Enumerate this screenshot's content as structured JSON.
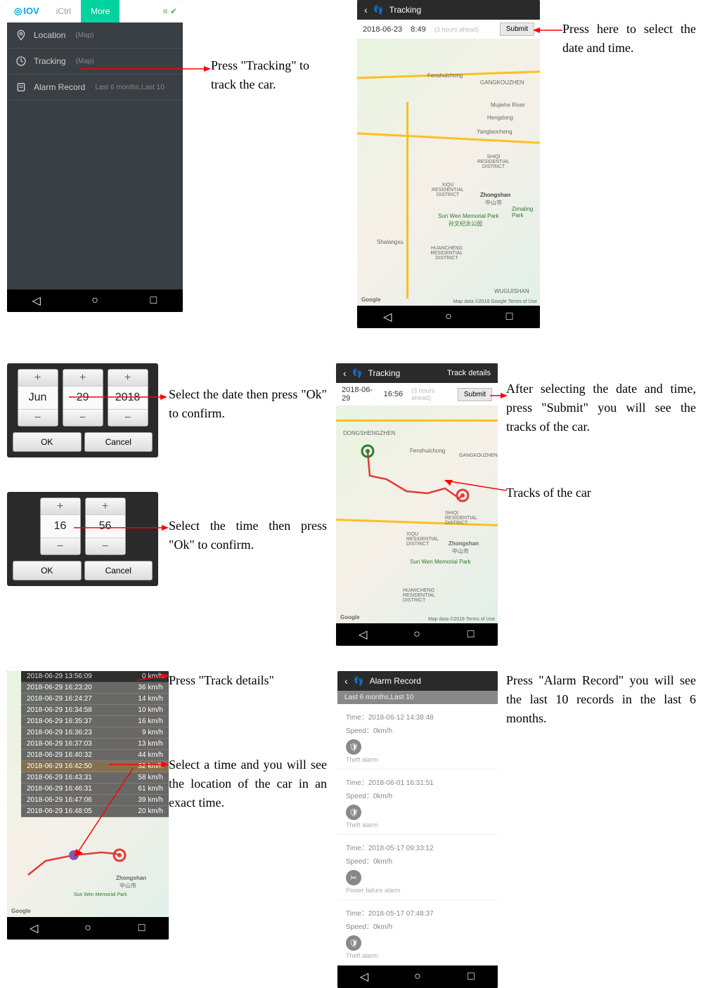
{
  "screen1": {
    "logo": "IOV",
    "tabs": {
      "ictrl": "iCtrl",
      "more": "More"
    },
    "items": [
      {
        "label": "Location",
        "sub": "(Map)"
      },
      {
        "label": "Tracking",
        "sub": "(Map)"
      },
      {
        "label": "Alarm Record",
        "sub": "Last 6 months,Last 10"
      }
    ]
  },
  "annot1": "Press \"Tracking\" to track the car.",
  "screen2": {
    "title": "Tracking",
    "date": "2018-06-23",
    "time": "8:49",
    "hint": "(3 hours ahead)",
    "submit": "Submit",
    "map_labels": {
      "zhongshan": "Zhongshan",
      "zhongshan_cn": "中山市",
      "sunwen": "Sun Wen Memorial Park",
      "sunwen_cn": "孙文纪念公园",
      "fenshuichong": "Fenshuichong",
      "gangkou": "GANGKOUZHEN",
      "shiqi": "SHIQI RESIDENTIAL DISTRICT",
      "xiqu": "XIQU RESIDENTIAL DISTRICT",
      "zimaling": "Zimaling Park",
      "huancheng": "HUANCHENG RESIDENTIAL DISTRICT",
      "mujiehe": "Mujiehe River",
      "hengdong": "Hengdong",
      "yanglaocheng": "Yanglaocheng",
      "shalang": "Shalangxu",
      "wugui": "WUGUISHAN",
      "dongsheng": "DONGSHENGZHEN"
    },
    "google": "Google",
    "attrib": "Map data ©2018 Google   Terms of Use"
  },
  "annot2": "Press here to select the date and time.",
  "picker_date": {
    "month": "Jun",
    "day": "29",
    "year": "2018",
    "ok": "OK",
    "cancel": "Cancel"
  },
  "annot3": "Select the date then press \"Ok\" to confirm.",
  "picker_time": {
    "hour": "16",
    "min": "56",
    "ok": "OK",
    "cancel": "Cancel"
  },
  "annot4": "Select the time then press \"Ok\" to confirm.",
  "screen3": {
    "title": "Tracking",
    "right": "Track details",
    "date": "2018-06-29",
    "time": "16:56",
    "hint": "(3 hours ahead)",
    "submit": "Submit"
  },
  "annot5": "After selecting the date and time, press \"Submit\" you will see the tracks of the car.",
  "annot6": "Tracks of the car",
  "screen4": {
    "date": "2018-06-29",
    "rows": [
      {
        "t": "2018-06-29 13:56:09",
        "s": "0 km/h"
      },
      {
        "t": "2018-06-29 16:23:20",
        "s": "36 km/h"
      },
      {
        "t": "2018-06-29 16:24:27",
        "s": "14 km/h"
      },
      {
        "t": "2018-06-29 16:34:58",
        "s": "10 km/h"
      },
      {
        "t": "2018-06-29 16:35:37",
        "s": "16 km/h"
      },
      {
        "t": "2018-06-29 16:36:23",
        "s": "9 km/h"
      },
      {
        "t": "2018-06-29 16:37:03",
        "s": "13 km/h"
      },
      {
        "t": "2018-06-29 16:40:32",
        "s": "44 km/h"
      },
      {
        "t": "2018-06-29 16:42:50",
        "s": "32 km/h"
      },
      {
        "t": "2018-06-29 16:43:31",
        "s": "58 km/h"
      },
      {
        "t": "2018-06-29 16:46:31",
        "s": "61 km/h"
      },
      {
        "t": "2018-06-29 16:47:06",
        "s": "39 km/h"
      },
      {
        "t": "2018-06-29 16:48:05",
        "s": "20 km/h"
      }
    ]
  },
  "annot7": "Press \"Track details\"",
  "annot8": "Select a time and you will see the location of the car in an exact time.",
  "screen5": {
    "title": "Alarm Record",
    "sub": "Last 6 months,Last 10",
    "records": [
      {
        "time": "Time：2018-06-12 14:38:48",
        "speed": "Speed：0km/h",
        "type": "Theft alarm",
        "icon": "shield"
      },
      {
        "time": "Time：2018-06-01 16:31:51",
        "speed": "Speed：0km/h",
        "type": "Theft alarm",
        "icon": "shield"
      },
      {
        "time": "Time：2018-05-17 09:33:12",
        "speed": "Speed：0km/h",
        "type": "Power failure alarm",
        "icon": "power"
      },
      {
        "time": "Time：2018-05-17 07:48:37",
        "speed": "Speed：0km/h",
        "type": "Theft alarm",
        "icon": "shield"
      }
    ]
  },
  "annot9": "Press \"Alarm Record\" you will see the last 10 records in the last 6 months."
}
